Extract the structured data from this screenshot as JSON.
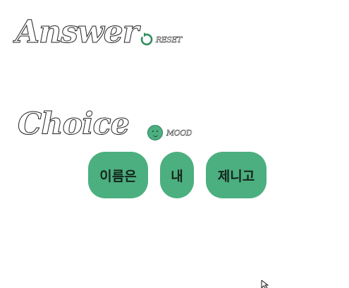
{
  "answer": {
    "title": "Answer",
    "reset_label": "RESET"
  },
  "choice": {
    "title": "Choice",
    "mood_label": "MOOD"
  },
  "choices": [
    {
      "label": "이름은"
    },
    {
      "label": "내"
    },
    {
      "label": "제니고"
    }
  ],
  "colors": {
    "accent": "#4caf80",
    "choice_text": "#15261c",
    "outline": "#222222"
  },
  "icons": {
    "reset": "reset-icon",
    "mood": "smiley-icon",
    "cursor": "mouse-pointer-icon"
  }
}
